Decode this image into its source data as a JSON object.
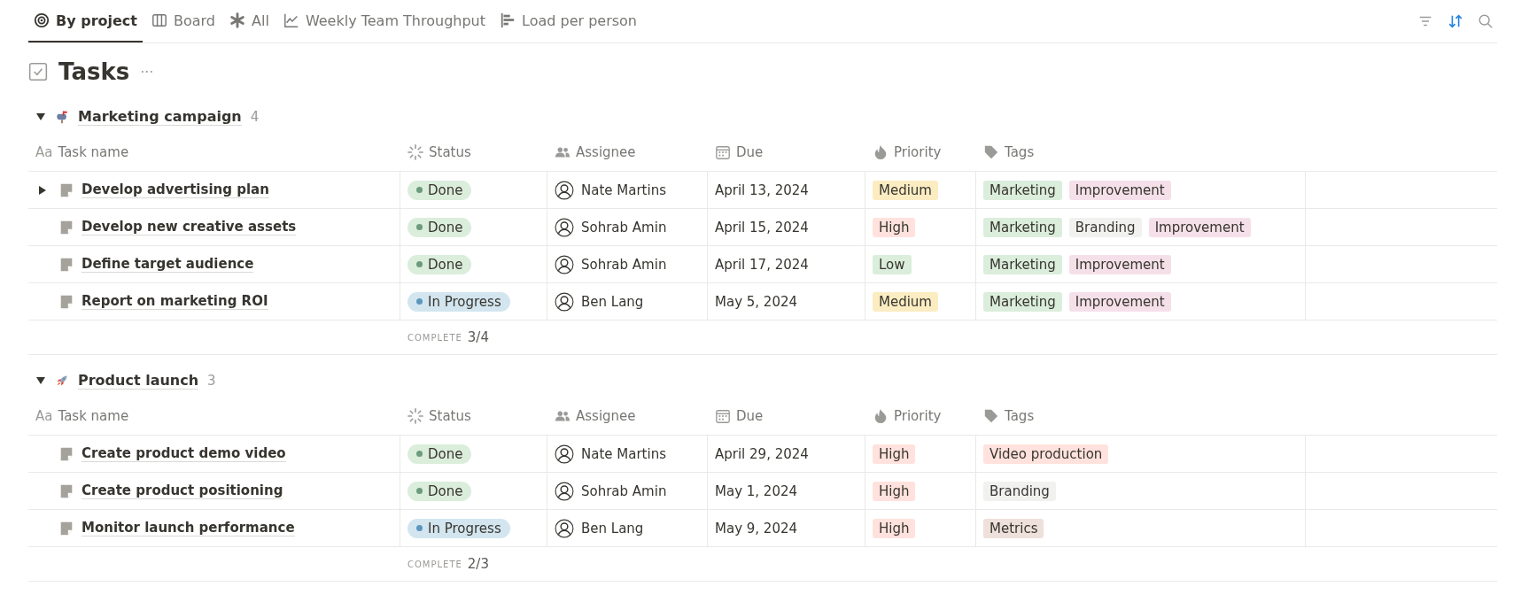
{
  "tabs": [
    {
      "label": "By project",
      "selected": true
    },
    {
      "label": "Board",
      "selected": false
    },
    {
      "label": "All",
      "selected": false
    },
    {
      "label": "Weekly Team Throughput",
      "selected": false
    },
    {
      "label": "Load per person",
      "selected": false
    }
  ],
  "title": "Tasks",
  "title_menu": "···",
  "groups": [
    {
      "name": "Marketing campaign",
      "count": "4",
      "expanded": true,
      "columns": [
        {
          "label": "Task name",
          "type_hint": "Aa"
        },
        {
          "label": "Status"
        },
        {
          "label": "Assignee"
        },
        {
          "label": "Due"
        },
        {
          "label": "Priority"
        },
        {
          "label": "Tags"
        }
      ],
      "rows": [
        {
          "task": "Develop advertising plan",
          "expanded": false,
          "status": {
            "label": "Done",
            "kind": "done",
            "color": "#dbeddb"
          },
          "assignee": "Nate Martins",
          "due": "April 13, 2024",
          "priority": {
            "label": "Medium",
            "color": "#fbecc2"
          },
          "tags": [
            {
              "label": "Marketing",
              "color": "#dbeddb"
            },
            {
              "label": "Improvement",
              "color": "#f5e0e9"
            }
          ]
        },
        {
          "task": "Develop new creative assets",
          "status": {
            "label": "Done",
            "kind": "done",
            "color": "#dbeddb"
          },
          "assignee": "Sohrab Amin",
          "due": "April 15, 2024",
          "priority": {
            "label": "High",
            "color": "#ffe2dd"
          },
          "tags": [
            {
              "label": "Marketing",
              "color": "#dbeddb"
            },
            {
              "label": "Branding",
              "color": "#f1f1ef"
            },
            {
              "label": "Improvement",
              "color": "#f5e0e9"
            }
          ]
        },
        {
          "task": "Define target audience",
          "status": {
            "label": "Done",
            "kind": "done",
            "color": "#dbeddb"
          },
          "assignee": "Sohrab Amin",
          "due": "April 17, 2024",
          "priority": {
            "label": "Low",
            "color": "#dbeddb"
          },
          "tags": [
            {
              "label": "Marketing",
              "color": "#dbeddb"
            },
            {
              "label": "Improvement",
              "color": "#f5e0e9"
            }
          ]
        },
        {
          "task": "Report on marketing ROI",
          "status": {
            "label": "In Progress",
            "kind": "in_progress",
            "color": "#d3e5ef"
          },
          "assignee": "Ben Lang",
          "due": "May 5, 2024",
          "priority": {
            "label": "Medium",
            "color": "#fbecc2"
          },
          "tags": [
            {
              "label": "Marketing",
              "color": "#dbeddb"
            },
            {
              "label": "Improvement",
              "color": "#f5e0e9"
            }
          ]
        }
      ],
      "footer": {
        "label": "COMPLETE",
        "value": "3/4"
      }
    },
    {
      "name": "Product launch",
      "count": "3",
      "expanded": true,
      "columns": [
        {
          "label": "Task name",
          "type_hint": "Aa"
        },
        {
          "label": "Status"
        },
        {
          "label": "Assignee"
        },
        {
          "label": "Due"
        },
        {
          "label": "Priority"
        },
        {
          "label": "Tags"
        }
      ],
      "rows": [
        {
          "task": "Create product demo video",
          "status": {
            "label": "Done",
            "kind": "done",
            "color": "#dbeddb"
          },
          "assignee": "Nate Martins",
          "due": "April 29, 2024",
          "priority": {
            "label": "High",
            "color": "#ffe2dd"
          },
          "tags": [
            {
              "label": "Video production",
              "color": "#ffe2dd"
            }
          ]
        },
        {
          "task": "Create product positioning",
          "status": {
            "label": "Done",
            "kind": "done",
            "color": "#dbeddb"
          },
          "assignee": "Sohrab Amin",
          "due": "May 1, 2024",
          "priority": {
            "label": "High",
            "color": "#ffe2dd"
          },
          "tags": [
            {
              "label": "Branding",
              "color": "#f1f1ef"
            }
          ]
        },
        {
          "task": "Monitor launch performance",
          "status": {
            "label": "In Progress",
            "kind": "in_progress",
            "color": "#d3e5ef"
          },
          "assignee": "Ben Lang",
          "due": "May 9, 2024",
          "priority": {
            "label": "High",
            "color": "#ffe2dd"
          },
          "tags": [
            {
              "label": "Metrics",
              "color": "#eee0da"
            }
          ]
        }
      ],
      "footer": {
        "label": "COMPLETE",
        "value": "2/3"
      }
    }
  ]
}
